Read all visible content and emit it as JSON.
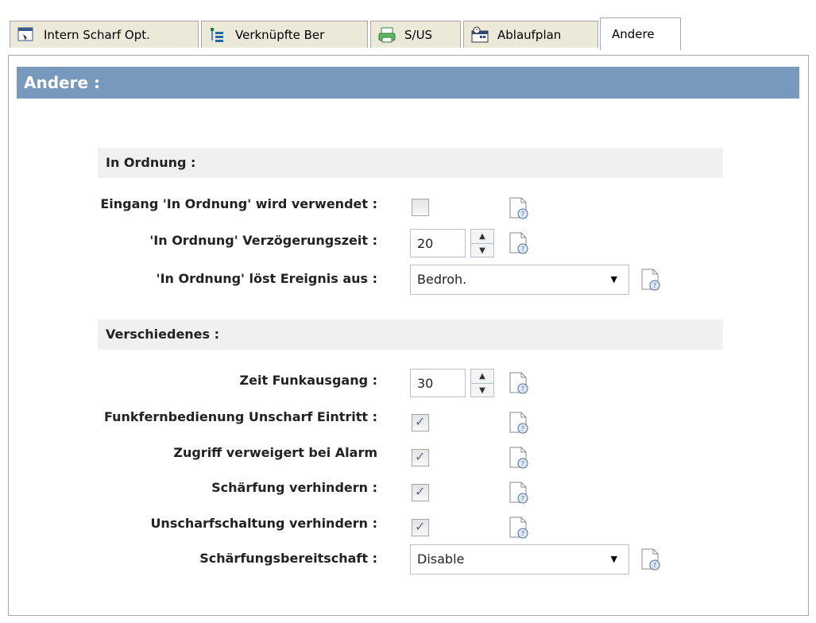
{
  "tabs": [
    {
      "label": "Intern Scharf Opt.",
      "icon": "arm-options-icon"
    },
    {
      "label": "Verknüpfte Ber",
      "icon": "linked-areas-icon"
    },
    {
      "label": "S/US",
      "icon": "printer-icon"
    },
    {
      "label": "Ablaufplan",
      "icon": "schedule-icon"
    },
    {
      "label": "Andere",
      "icon": ""
    }
  ],
  "header": {
    "title": "Andere :"
  },
  "sections": {
    "in_ordnung": "In Ordnung :",
    "verschiedenes": "Verschiedenes :"
  },
  "fields": {
    "eingang": {
      "label": "Eingang 'In Ordnung' wird verwendet :",
      "checked": false
    },
    "verzoegerung": {
      "label": "'In Ordnung' Verzögerungszeit :",
      "value": "20"
    },
    "ereignis": {
      "label": "'In Ordnung' löst Ereignis aus :",
      "value": "Bedroh."
    },
    "zeit_funk": {
      "label": "Zeit Funkausgang :",
      "value": "30"
    },
    "funkfern": {
      "label": "Funkfernbedienung Unscharf Eintritt :",
      "checked": true
    },
    "zugriff": {
      "label": "Zugriff verweigert bei Alarm",
      "checked": true
    },
    "schaerfung": {
      "label": "Schärfung verhindern :",
      "checked": true
    },
    "unscharf": {
      "label": "Unscharfschaltung verhindern :",
      "checked": true
    },
    "bereitschaft": {
      "label": "Schärfungsbereitschaft :",
      "value": "Disable"
    }
  },
  "colors": {
    "header_bg": "#7799bd",
    "section_bg": "#f0f0f0"
  }
}
